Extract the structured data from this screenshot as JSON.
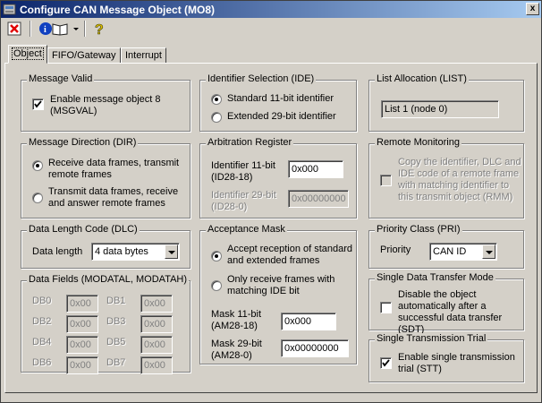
{
  "window": {
    "title": "Configure CAN Message Object (MO8)",
    "close_label": "x"
  },
  "toolbar": {
    "icons": [
      "close-config-icon",
      "info-book-icon",
      "dropdown-arrow-icon",
      "help-icon"
    ]
  },
  "tabs": [
    {
      "label": "Object",
      "active": true
    },
    {
      "label": "FIFO/Gateway",
      "active": false
    },
    {
      "label": "Interrupt",
      "active": false
    }
  ],
  "message_valid": {
    "title": "Message Valid",
    "checkbox_label": "Enable message object 8 (MSGVAL)",
    "checked": true
  },
  "identifier_selection": {
    "title": "Identifier Selection (IDE)",
    "option_standard": "Standard 11-bit identifier",
    "option_extended": "Extended 29-bit identifier",
    "selected": "standard"
  },
  "list_allocation": {
    "title": "List Allocation (LIST)",
    "value": "List 1 (node 0)"
  },
  "message_direction": {
    "title": "Message Direction (DIR)",
    "option_receive": "Receive data frames, transmit remote frames",
    "option_transmit": "Transmit data frames, receive and answer remote frames",
    "selected": "receive"
  },
  "arbitration": {
    "title": "Arbitration Register",
    "id11_label": "Identifier 11-bit (ID28-18)",
    "id11_value": "0x000",
    "id29_label": "Identifier 29-bit (ID28-0)",
    "id29_value": "0x00000000"
  },
  "remote_monitoring": {
    "title": "Remote Monitoring",
    "checkbox_label": "Copy the identifier, DLC and IDE code of a remote frame with matching identifier to this transmit object (RMM)",
    "checked": false
  },
  "dlc": {
    "title": "Data Length Code (DLC)",
    "label": "Data length",
    "value": "4 data bytes"
  },
  "acceptance_mask": {
    "title": "Acceptance Mask",
    "option_accept": "Accept reception of standard and extended frames",
    "option_only": "Only receive frames with matching IDE bit",
    "selected": "accept",
    "mask11_label": "Mask 11-bit (AM28-18)",
    "mask11_value": "0x000",
    "mask29_label": "Mask 29-bit (AM28-0)",
    "mask29_value": "0x00000000"
  },
  "priority_class": {
    "title": "Priority Class (PRI)",
    "label": "Priority",
    "value": "CAN ID"
  },
  "data_fields": {
    "title": "Data Fields (MODATAL, MODATAH)",
    "db0": {
      "label": "DB0",
      "value": "0x00"
    },
    "db1": {
      "label": "DB1",
      "value": "0x00"
    },
    "db2": {
      "label": "DB2",
      "value": "0x00"
    },
    "db3": {
      "label": "DB3",
      "value": "0x00"
    },
    "db4": {
      "label": "DB4",
      "value": "0x00"
    },
    "db5": {
      "label": "DB5",
      "value": "0x00"
    },
    "db6": {
      "label": "DB6",
      "value": "0x00"
    },
    "db7": {
      "label": "DB7",
      "value": "0x00"
    }
  },
  "single_data_transfer": {
    "title": "Single Data Transfer Mode",
    "checkbox_label": "Disable the object automatically after a successful data transfer (SDT)",
    "checked": false
  },
  "single_transmission": {
    "title": "Single Transmission Trial",
    "checkbox_label": "Enable single transmission trial (STT)",
    "checked": true
  },
  "colors": {
    "titlebar_start": "#0a246a",
    "titlebar_end": "#a6caf0",
    "face": "#d4d0c8"
  }
}
